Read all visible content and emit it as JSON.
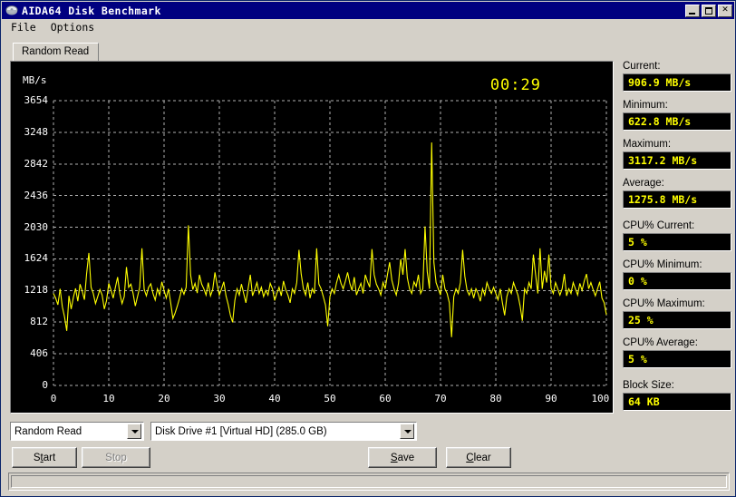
{
  "window": {
    "title": "AIDA64 Disk Benchmark",
    "icon": "disk-icon",
    "buttons": {
      "minimize": "minimize-icon",
      "maximize": "maximize-icon",
      "close": "✕"
    }
  },
  "menu": {
    "items": [
      {
        "label": "File"
      },
      {
        "label": "Options"
      }
    ]
  },
  "tabs": [
    {
      "label": "Random Read"
    }
  ],
  "chart_data": {
    "type": "line",
    "title": "",
    "xlabel": "%",
    "ylabel": "MB/s",
    "unit_label": "MB/s",
    "x_unit_suffix": "%",
    "grid": true,
    "legend": "none",
    "xlim": [
      0,
      100
    ],
    "ylim": [
      0,
      3654
    ],
    "xticks": [
      0,
      10,
      20,
      30,
      40,
      50,
      60,
      70,
      80,
      90,
      100
    ],
    "xtick_labels": [
      "0",
      "10",
      "20",
      "30",
      "40",
      "50",
      "60",
      "70",
      "80",
      "90",
      "100 %"
    ],
    "yticks": [
      0,
      406,
      812,
      1218,
      1624,
      2030,
      2436,
      2842,
      3248,
      3654
    ],
    "ytick_labels": [
      "0",
      "406",
      "812",
      "1218",
      "1624",
      "2030",
      "2436",
      "2842",
      "3248",
      "3654"
    ],
    "line_color": "#ffff00",
    "background_color": "#000000",
    "grid_color": "#b0b0b0",
    "series": [
      {
        "name": "Random Read",
        "x": [
          0.0,
          0.4,
          0.8,
          1.2,
          1.6,
          2.0,
          2.4,
          2.8,
          3.2,
          3.6,
          4.0,
          4.4,
          4.8,
          5.2,
          5.6,
          6.0,
          6.4,
          6.8,
          7.2,
          7.6,
          8.0,
          8.4,
          8.8,
          9.2,
          9.6,
          10.0,
          10.4,
          10.8,
          11.2,
          11.6,
          12.0,
          12.4,
          12.8,
          13.2,
          13.6,
          14.0,
          14.4,
          14.8,
          15.2,
          15.6,
          16.0,
          16.4,
          16.8,
          17.2,
          17.6,
          18.0,
          18.4,
          18.8,
          19.2,
          19.6,
          20.0,
          20.4,
          20.8,
          21.2,
          21.6,
          22.0,
          22.4,
          22.8,
          23.2,
          23.6,
          24.0,
          24.4,
          24.8,
          25.2,
          25.6,
          26.0,
          26.4,
          26.8,
          27.2,
          27.6,
          28.0,
          28.4,
          28.8,
          29.2,
          29.6,
          30.0,
          30.4,
          30.8,
          31.2,
          31.6,
          32.0,
          32.4,
          32.8,
          33.2,
          33.6,
          34.0,
          34.4,
          34.8,
          35.2,
          35.6,
          36.0,
          36.4,
          36.8,
          37.2,
          37.6,
          38.0,
          38.4,
          38.8,
          39.2,
          39.6,
          40.0,
          40.4,
          40.8,
          41.2,
          41.6,
          42.0,
          42.4,
          42.8,
          43.2,
          43.6,
          44.0,
          44.4,
          44.8,
          45.2,
          45.6,
          46.0,
          46.4,
          46.8,
          47.2,
          47.6,
          48.0,
          48.4,
          48.8,
          49.2,
          49.6,
          50.0,
          50.4,
          50.8,
          51.2,
          51.6,
          52.0,
          52.4,
          52.8,
          53.2,
          53.6,
          54.0,
          54.4,
          54.8,
          55.2,
          55.6,
          56.0,
          56.4,
          56.8,
          57.2,
          57.6,
          58.0,
          58.4,
          58.8,
          59.2,
          59.6,
          60.0,
          60.4,
          60.8,
          61.2,
          61.6,
          62.0,
          62.4,
          62.8,
          63.2,
          63.6,
          64.0,
          64.4,
          64.8,
          65.2,
          65.6,
          66.0,
          66.4,
          66.8,
          67.2,
          67.6,
          68.0,
          68.4,
          68.8,
          69.2,
          69.6,
          70.0,
          70.4,
          70.8,
          71.2,
          71.6,
          72.0,
          72.4,
          72.8,
          73.2,
          73.6,
          74.0,
          74.4,
          74.8,
          75.2,
          75.6,
          76.0,
          76.4,
          76.8,
          77.2,
          77.6,
          78.0,
          78.4,
          78.8,
          79.2,
          79.6,
          80.0,
          80.4,
          80.8,
          81.2,
          81.6,
          82.0,
          82.4,
          82.8,
          83.2,
          83.6,
          84.0,
          84.4,
          84.8,
          85.2,
          85.6,
          86.0,
          86.4,
          86.8,
          87.2,
          87.6,
          88.0,
          88.4,
          88.8,
          89.2,
          89.6,
          90.0,
          90.4,
          90.8,
          91.2,
          91.6,
          92.0,
          92.4,
          92.8,
          93.2,
          93.6,
          94.0,
          94.4,
          94.8,
          95.2,
          95.6,
          96.0,
          96.4,
          96.8,
          97.2,
          97.6,
          98.0,
          98.4,
          98.8,
          99.2,
          99.6,
          100.0
        ],
        "y": [
          1180,
          1120,
          1035,
          1240,
          1010,
          880,
          700,
          1150,
          980,
          1130,
          1245,
          1080,
          1300,
          1210,
          1100,
          1440,
          1700,
          1260,
          1180,
          1050,
          1140,
          1230,
          1160,
          980,
          1090,
          1310,
          1225,
          1120,
          1260,
          1390,
          1180,
          1050,
          1140,
          1520,
          1260,
          1300,
          1180,
          1020,
          1140,
          1260,
          1760,
          1235,
          1150,
          1260,
          1305,
          1180,
          1095,
          1240,
          1160,
          1330,
          1220,
          1120,
          1240,
          1060,
          860,
          930,
          1020,
          1120,
          1240,
          1170,
          1260,
          2055,
          1420,
          1230,
          1310,
          1185,
          1420,
          1300,
          1240,
          1160,
          1320,
          1150,
          1230,
          1450,
          1290,
          1160,
          1240,
          1330,
          1150,
          1040,
          900,
          810,
          1090,
          1240,
          1160,
          1300,
          1180,
          1060,
          1240,
          1420,
          1150,
          1230,
          1320,
          1180,
          1260,
          1140,
          1220,
          1160,
          1310,
          1240,
          1090,
          1180,
          1260,
          1150,
          1340,
          1230,
          1160,
          1060,
          1240,
          1180,
          1320,
          1740,
          1430,
          1240,
          1160,
          1320,
          1120,
          1240,
          1180,
          1760,
          1300,
          1240,
          1140,
          1030,
          760,
          1140,
          1240,
          1180,
          1320,
          1420,
          1310,
          1240,
          1340,
          1450,
          1310,
          1220,
          1390,
          1160,
          1240,
          1310,
          1180,
          1420,
          1330,
          1260,
          1750,
          1420,
          1300,
          1240,
          1160,
          1320,
          1240,
          1420,
          1580,
          1350,
          1240,
          1160,
          1310,
          1620,
          1420,
          1750,
          1380,
          1240,
          1180,
          1330,
          1270,
          1420,
          1180,
          1240,
          2040,
          1460,
          1240,
          3117,
          1580,
          1320,
          1240,
          1160,
          1420,
          1240,
          1180,
          1060,
          620,
          1140,
          1240,
          1180,
          1320,
          1740,
          1400,
          1220,
          1160,
          1240,
          1120,
          1240,
          1180,
          1080,
          1240,
          1160,
          1320,
          1240,
          1180,
          1260,
          1180,
          1100,
          1240,
          1060,
          900,
          1140,
          1240,
          1180,
          1320,
          1240,
          1160,
          1020,
          830,
          1240,
          1180,
          1320,
          1240,
          1680,
          1420,
          1180,
          1760,
          1240,
          1470,
          1320,
          1680,
          1250,
          1180,
          1320,
          1240,
          1160,
          1240,
          1430,
          1150,
          1240,
          1180,
          1320,
          1240,
          1160,
          1310,
          1220,
          1340,
          1430,
          1240,
          1320,
          1230,
          1150,
          1240,
          1330,
          1120,
          1060,
          907
        ]
      }
    ],
    "timer": "00:29"
  },
  "stats": [
    {
      "name": "current",
      "label": "Current:",
      "value": "906.9 MB/s"
    },
    {
      "name": "minimum",
      "label": "Minimum:",
      "value": "622.8 MB/s"
    },
    {
      "name": "maximum",
      "label": "Maximum:",
      "value": "3117.2 MB/s"
    },
    {
      "name": "average",
      "label": "Average:",
      "value": "1275.8 MB/s"
    },
    {
      "name": "cpu-current",
      "label": "CPU% Current:",
      "value": "5 %"
    },
    {
      "name": "cpu-minimum",
      "label": "CPU% Minimum:",
      "value": "0 %"
    },
    {
      "name": "cpu-maximum",
      "label": "CPU% Maximum:",
      "value": "25 %"
    },
    {
      "name": "cpu-average",
      "label": "CPU% Average:",
      "value": "5 %"
    },
    {
      "name": "block-size",
      "label": "Block Size:",
      "value": "64 KB"
    }
  ],
  "controls": {
    "test_select": {
      "value": "Random Read"
    },
    "drive_select": {
      "value": "Disk Drive #1 [Virtual HD]  (285.0 GB)"
    },
    "start_button": {
      "label": "Start",
      "accel": "t"
    },
    "stop_button": {
      "label": "Stop",
      "accel": "S",
      "disabled": true
    },
    "save_button": {
      "label": "Save",
      "accel": "S"
    },
    "clear_button": {
      "label": "Clear",
      "accel": "C"
    }
  },
  "statusbar": {
    "text": ""
  }
}
